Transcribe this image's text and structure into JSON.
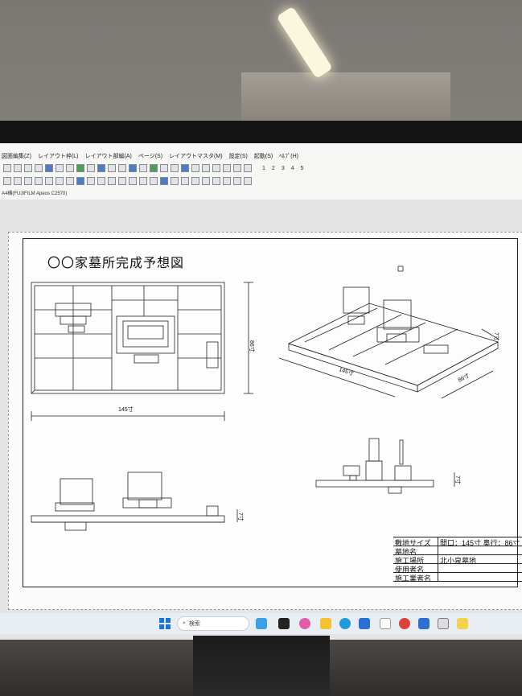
{
  "menu": [
    "図面編集(Z)",
    "レイアウト枠(L)",
    "レイアウト部編(A)",
    "ページ(S)",
    "レイアウトマスタ(M)",
    "設定(S)",
    "起動(S)",
    "ﾍﾙﾌﾟ(H)"
  ],
  "page_numbers": [
    "1",
    "2",
    "3",
    "4",
    "5"
  ],
  "printer_label": "A4横(FUJIFILM Apeos C2570)",
  "drawing": {
    "title": "〇〇家墓所完成予想図",
    "dim_width": "145寸",
    "dim_depth": "86寸",
    "dim_iso_width": "145寸",
    "dim_iso_depth": "86寸",
    "dim_height_small": "7寸",
    "dim_height_side": "7寸",
    "dim_height_iso": "7寸"
  },
  "title_block": [
    {
      "key": "敷地サイズ",
      "value": "間口：145寸 奥行：86寸"
    },
    {
      "key": "墓地名",
      "value": ""
    },
    {
      "key": "施工場所",
      "value": "北小泉墓地"
    },
    {
      "key": "使用者名",
      "value": ""
    },
    {
      "key": "施工業者名",
      "value": ""
    }
  ],
  "taskbar": {
    "search_placeholder": "検索"
  },
  "colors": {
    "accent": "#1a73d9",
    "sheet_line": "#222222"
  }
}
